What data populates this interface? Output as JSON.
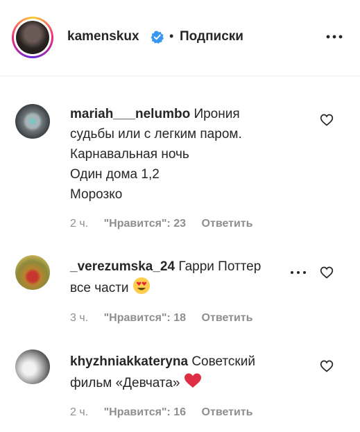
{
  "header": {
    "username": "kamenskux",
    "separator": "•",
    "follow_status": "Подписки"
  },
  "comments": [
    {
      "username": "mariah___nelumbo",
      "lines": [
        "Ирония",
        "судьбы или с легким паром.",
        "Карнавальная ночь",
        "Один дома 1,2",
        "Морозко"
      ],
      "time": "2 ч.",
      "likes": "\"Нравится\": 23",
      "reply": "Ответить"
    },
    {
      "username": "_verezumska_24",
      "lines": [
        "Гарри Поттер",
        "все части"
      ],
      "emoji": "heart-eyes-emoji",
      "time": "3 ч.",
      "likes": "\"Нравится\": 18",
      "reply": "Ответить"
    },
    {
      "username": "khyzhniakkateryna",
      "lines": [
        "Советский",
        "фильм «Девчата»"
      ],
      "emoji": "red-heart-emoji",
      "time": "2 ч.",
      "likes": "\"Нравится\": 16",
      "reply": "Ответить"
    }
  ],
  "colors": {
    "text": "#262626",
    "muted": "#8e8e8e",
    "verified": "#3897f0",
    "divider": "#efefef"
  },
  "icons": [
    "verified-badge-icon",
    "more-options-icon",
    "like-heart-icon",
    "comment-options-icon"
  ]
}
